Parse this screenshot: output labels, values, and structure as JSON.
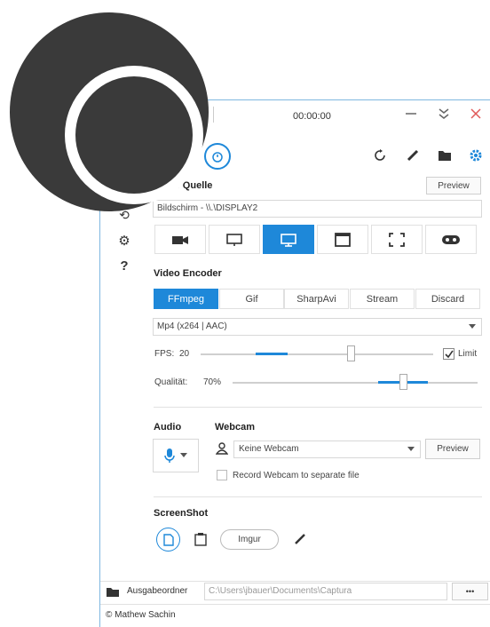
{
  "window": {
    "timer": "00:00:00"
  },
  "sidebar": {
    "items": [
      {
        "icon": "history-icon",
        "glyph": "⟲"
      },
      {
        "icon": "gear-icon",
        "glyph": "⚙"
      },
      {
        "icon": "help-icon",
        "glyph": "?"
      }
    ]
  },
  "video_source": {
    "title": "Video Quelle",
    "preview_label": "Preview",
    "value": "Bildschirm - \\\\.\\DISPLAY2",
    "sources": [
      {
        "name": "webcam",
        "glyph": "■"
      },
      {
        "name": "window",
        "glyph": "▭"
      },
      {
        "name": "screen",
        "glyph": "▭",
        "selected": true
      },
      {
        "name": "region",
        "glyph": "▣"
      },
      {
        "name": "fullscreen",
        "glyph": "⛶"
      },
      {
        "name": "gamepad",
        "glyph": "⬬"
      }
    ]
  },
  "video_encoder": {
    "title": "Video Encoder",
    "tabs": [
      "FFmpeg",
      "Gif",
      "SharpAvi",
      "Stream",
      "Discard"
    ],
    "selected_tab": "FFmpeg",
    "codec": "Mp4 (x264 | AAC)",
    "fps_label": "FPS:",
    "fps_value": "20",
    "fps_level": 0.45,
    "limit_label": "Limit",
    "limit_checked": true,
    "quality_label": "Qualität:",
    "quality_value": "70%",
    "quality_level": 0.7
  },
  "audio": {
    "title": "Audio"
  },
  "webcam": {
    "title": "Webcam",
    "selected": "Keine Webcam",
    "preview_label": "Preview",
    "separate_file_label": "Record Webcam to separate file"
  },
  "screenshot": {
    "title": "ScreenShot",
    "imgur_label": "Imgur"
  },
  "output": {
    "label": "Ausgabeordner",
    "path": "C:\\Users\\jbauer\\Documents\\Captura",
    "browse_label": "•••"
  },
  "footer": {
    "copyright": "© Mathew Sachin"
  },
  "colors": {
    "accent": "#1e88d9",
    "close": "#e05a5a",
    "logo_dark": "#3a3a3a"
  }
}
